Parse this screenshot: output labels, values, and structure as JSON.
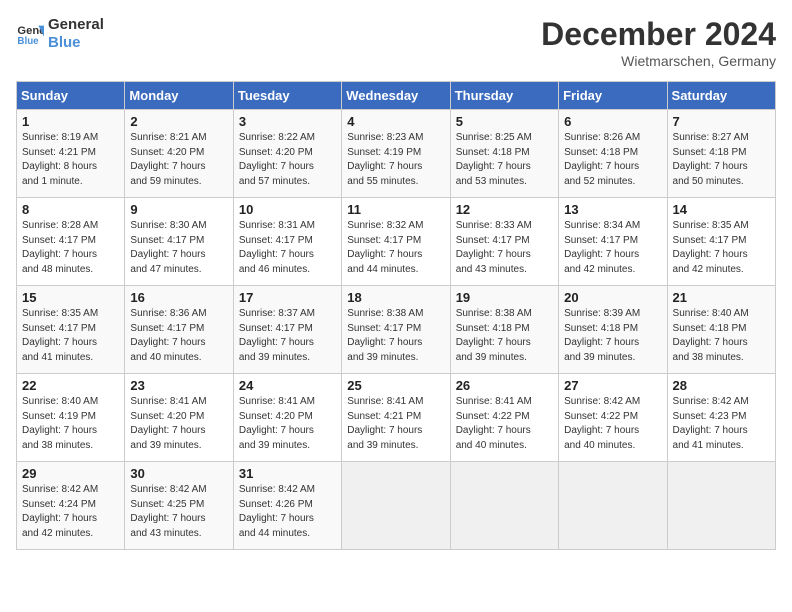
{
  "header": {
    "logo_line1": "General",
    "logo_line2": "Blue",
    "month": "December 2024",
    "location": "Wietmarschen, Germany"
  },
  "weekdays": [
    "Sunday",
    "Monday",
    "Tuesday",
    "Wednesday",
    "Thursday",
    "Friday",
    "Saturday"
  ],
  "weeks": [
    [
      {
        "day": "1",
        "sunrise": "8:19 AM",
        "sunset": "4:21 PM",
        "daylight": "8 hours and 1 minute."
      },
      {
        "day": "2",
        "sunrise": "8:21 AM",
        "sunset": "4:20 PM",
        "daylight": "7 hours and 59 minutes."
      },
      {
        "day": "3",
        "sunrise": "8:22 AM",
        "sunset": "4:20 PM",
        "daylight": "7 hours and 57 minutes."
      },
      {
        "day": "4",
        "sunrise": "8:23 AM",
        "sunset": "4:19 PM",
        "daylight": "7 hours and 55 minutes."
      },
      {
        "day": "5",
        "sunrise": "8:25 AM",
        "sunset": "4:18 PM",
        "daylight": "7 hours and 53 minutes."
      },
      {
        "day": "6",
        "sunrise": "8:26 AM",
        "sunset": "4:18 PM",
        "daylight": "7 hours and 52 minutes."
      },
      {
        "day": "7",
        "sunrise": "8:27 AM",
        "sunset": "4:18 PM",
        "daylight": "7 hours and 50 minutes."
      }
    ],
    [
      {
        "day": "8",
        "sunrise": "8:28 AM",
        "sunset": "4:17 PM",
        "daylight": "7 hours and 48 minutes."
      },
      {
        "day": "9",
        "sunrise": "8:30 AM",
        "sunset": "4:17 PM",
        "daylight": "7 hours and 47 minutes."
      },
      {
        "day": "10",
        "sunrise": "8:31 AM",
        "sunset": "4:17 PM",
        "daylight": "7 hours and 46 minutes."
      },
      {
        "day": "11",
        "sunrise": "8:32 AM",
        "sunset": "4:17 PM",
        "daylight": "7 hours and 44 minutes."
      },
      {
        "day": "12",
        "sunrise": "8:33 AM",
        "sunset": "4:17 PM",
        "daylight": "7 hours and 43 minutes."
      },
      {
        "day": "13",
        "sunrise": "8:34 AM",
        "sunset": "4:17 PM",
        "daylight": "7 hours and 42 minutes."
      },
      {
        "day": "14",
        "sunrise": "8:35 AM",
        "sunset": "4:17 PM",
        "daylight": "7 hours and 42 minutes."
      }
    ],
    [
      {
        "day": "15",
        "sunrise": "8:35 AM",
        "sunset": "4:17 PM",
        "daylight": "7 hours and 41 minutes."
      },
      {
        "day": "16",
        "sunrise": "8:36 AM",
        "sunset": "4:17 PM",
        "daylight": "7 hours and 40 minutes."
      },
      {
        "day": "17",
        "sunrise": "8:37 AM",
        "sunset": "4:17 PM",
        "daylight": "7 hours and 39 minutes."
      },
      {
        "day": "18",
        "sunrise": "8:38 AM",
        "sunset": "4:17 PM",
        "daylight": "7 hours and 39 minutes."
      },
      {
        "day": "19",
        "sunrise": "8:38 AM",
        "sunset": "4:18 PM",
        "daylight": "7 hours and 39 minutes."
      },
      {
        "day": "20",
        "sunrise": "8:39 AM",
        "sunset": "4:18 PM",
        "daylight": "7 hours and 39 minutes."
      },
      {
        "day": "21",
        "sunrise": "8:40 AM",
        "sunset": "4:18 PM",
        "daylight": "7 hours and 38 minutes."
      }
    ],
    [
      {
        "day": "22",
        "sunrise": "8:40 AM",
        "sunset": "4:19 PM",
        "daylight": "7 hours and 38 minutes."
      },
      {
        "day": "23",
        "sunrise": "8:41 AM",
        "sunset": "4:20 PM",
        "daylight": "7 hours and 39 minutes."
      },
      {
        "day": "24",
        "sunrise": "8:41 AM",
        "sunset": "4:20 PM",
        "daylight": "7 hours and 39 minutes."
      },
      {
        "day": "25",
        "sunrise": "8:41 AM",
        "sunset": "4:21 PM",
        "daylight": "7 hours and 39 minutes."
      },
      {
        "day": "26",
        "sunrise": "8:41 AM",
        "sunset": "4:22 PM",
        "daylight": "7 hours and 40 minutes."
      },
      {
        "day": "27",
        "sunrise": "8:42 AM",
        "sunset": "4:22 PM",
        "daylight": "7 hours and 40 minutes."
      },
      {
        "day": "28",
        "sunrise": "8:42 AM",
        "sunset": "4:23 PM",
        "daylight": "7 hours and 41 minutes."
      }
    ],
    [
      {
        "day": "29",
        "sunrise": "8:42 AM",
        "sunset": "4:24 PM",
        "daylight": "7 hours and 42 minutes."
      },
      {
        "day": "30",
        "sunrise": "8:42 AM",
        "sunset": "4:25 PM",
        "daylight": "7 hours and 43 minutes."
      },
      {
        "day": "31",
        "sunrise": "8:42 AM",
        "sunset": "4:26 PM",
        "daylight": "7 hours and 44 minutes."
      },
      null,
      null,
      null,
      null
    ]
  ],
  "labels": {
    "sunrise": "Sunrise:",
    "sunset": "Sunset:",
    "daylight": "Daylight hours"
  }
}
